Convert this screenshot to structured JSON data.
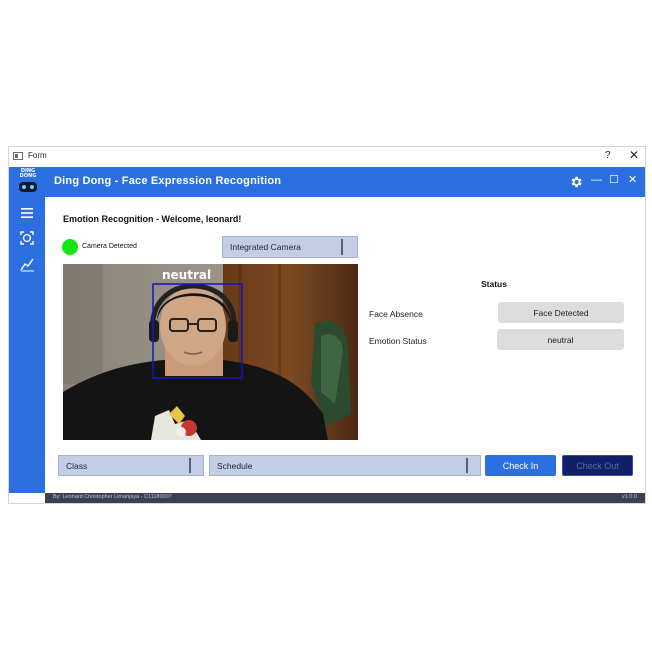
{
  "window": {
    "title": "Form",
    "help_glyph": "?",
    "close_glyph": "✕"
  },
  "app": {
    "logo_text": "DING\nDONG",
    "title": "Ding Dong - Face Expression Recognition",
    "controls": {
      "minimize": "—",
      "maximize": "☐",
      "close": "✕"
    }
  },
  "sidebar": {
    "items": [
      {
        "icon": "menu-icon"
      },
      {
        "icon": "face-scan-icon"
      },
      {
        "icon": "chart-icon"
      }
    ]
  },
  "main": {
    "heading": "Emotion Recognition - Welcome, leonard!",
    "camera_indicator": {
      "label": "Camera Detected",
      "color": "#14e614"
    },
    "camera_select": "Integrated Camera",
    "overlay_label": "neutral"
  },
  "status": {
    "title": "Status",
    "face_absence_label": "Face Absence",
    "face_absence_value": "Face Detected",
    "emotion_label": "Emotion Status",
    "emotion_value": "neutral"
  },
  "bottom": {
    "class_select": "Class",
    "schedule_select": "Schedule",
    "check_in": "Check In",
    "check_out": "Check Out"
  },
  "footer": {
    "credit": "By: Leonard Christopher Limanjaya - C11180007",
    "version": "v1.0.0"
  },
  "colors": {
    "accent": "#2b6fe0",
    "combo": "#c3cde6",
    "checkout": "#12206a",
    "footer": "#3b4150"
  }
}
